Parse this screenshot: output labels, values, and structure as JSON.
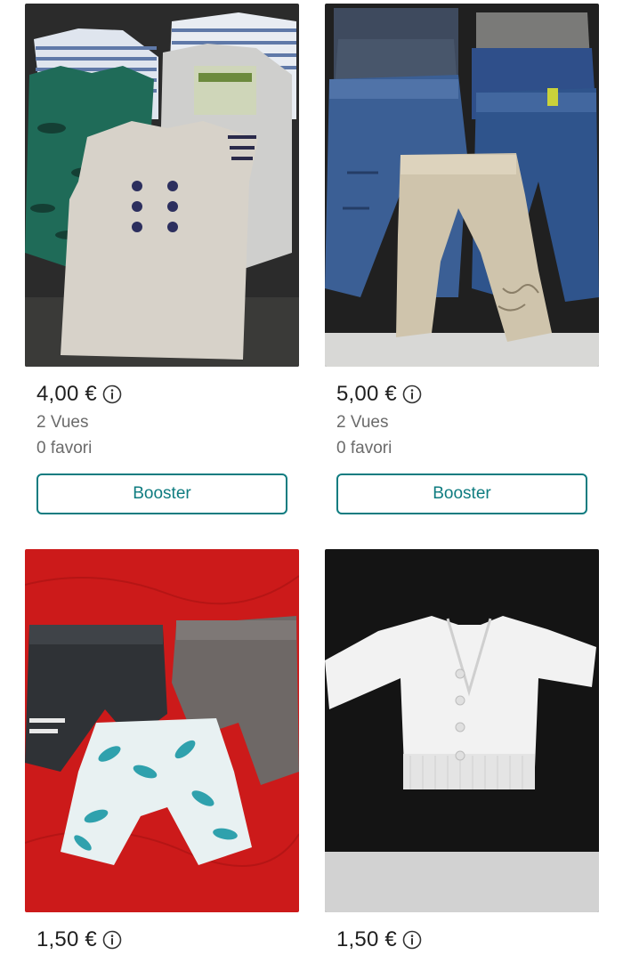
{
  "listings": [
    {
      "price": "4,00 €",
      "views": "2 Vues",
      "favorites": "0 favori",
      "action": "Booster",
      "photo": "baby-bodysuits"
    },
    {
      "price": "5,00 €",
      "views": "2 Vues",
      "favorites": "0 favori",
      "action": "Booster",
      "photo": "baby-trousers"
    },
    {
      "price": "1,50 €",
      "photo": "baby-shorts"
    },
    {
      "price": "1,50 €",
      "photo": "white-cardigan"
    }
  ],
  "colors": {
    "accent": "#0f7c80",
    "muted_text": "#6b6b6b"
  },
  "icons": {
    "info": "info-circle-icon"
  }
}
